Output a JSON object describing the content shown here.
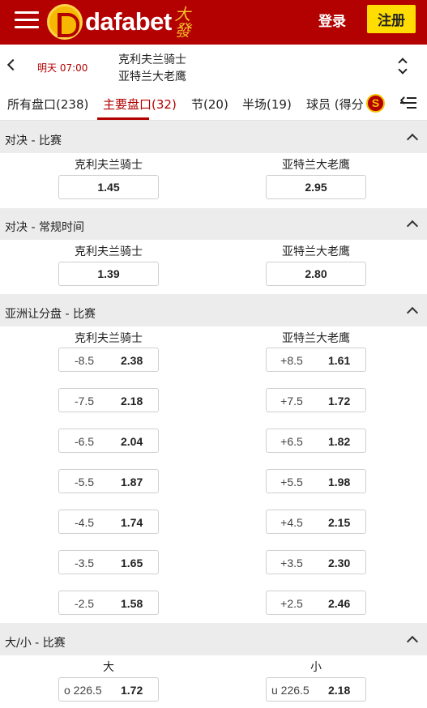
{
  "header": {
    "brand": "dafabet",
    "brand_cjk": "大發",
    "login_label": "登录",
    "register_label": "注册"
  },
  "match": {
    "time": "明天 07:00",
    "home": "克利夫兰骑士",
    "away": "亚特兰大老鹰"
  },
  "tabs": [
    {
      "label": "所有盘口(238)"
    },
    {
      "label": "主要盘口(32)"
    },
    {
      "label": "节(20)"
    },
    {
      "label": "半场(19)"
    },
    {
      "label": "球员 (得分"
    }
  ],
  "tabs_badge": "S",
  "sections": [
    {
      "title": "对决 - 比赛",
      "home_label": "克利夫兰骑士",
      "away_label": "亚特兰大老鹰",
      "home_price": "1.45",
      "away_price": "2.95"
    },
    {
      "title": "对决 - 常规时间",
      "home_label": "克利夫兰骑士",
      "away_label": "亚特兰大老鹰",
      "home_price": "1.39",
      "away_price": "2.80"
    },
    {
      "title": "亚洲让分盘 - 比赛",
      "home_label": "克利夫兰骑士",
      "away_label": "亚特兰大老鹰",
      "rows": [
        {
          "home_line": "-8.5",
          "home_price": "2.38",
          "away_line": "+8.5",
          "away_price": "1.61"
        },
        {
          "home_line": "-7.5",
          "home_price": "2.18",
          "away_line": "+7.5",
          "away_price": "1.72"
        },
        {
          "home_line": "-6.5",
          "home_price": "2.04",
          "away_line": "+6.5",
          "away_price": "1.82"
        },
        {
          "home_line": "-5.5",
          "home_price": "1.87",
          "away_line": "+5.5",
          "away_price": "1.98"
        },
        {
          "home_line": "-4.5",
          "home_price": "1.74",
          "away_line": "+4.5",
          "away_price": "2.15"
        },
        {
          "home_line": "-3.5",
          "home_price": "1.65",
          "away_line": "+3.5",
          "away_price": "2.30"
        },
        {
          "home_line": "-2.5",
          "home_price": "1.58",
          "away_line": "+2.5",
          "away_price": "2.46"
        }
      ]
    },
    {
      "title": "大/小 - 比赛",
      "over_label": "大",
      "under_label": "小",
      "over_line": "o 226.5",
      "over_price": "1.72",
      "under_line": "u 226.5",
      "under_price": "2.18"
    }
  ],
  "colors": {
    "brand_red": "#b30000",
    "register_yellow": "#ffdd00",
    "logo_gold": "#f6b800"
  }
}
